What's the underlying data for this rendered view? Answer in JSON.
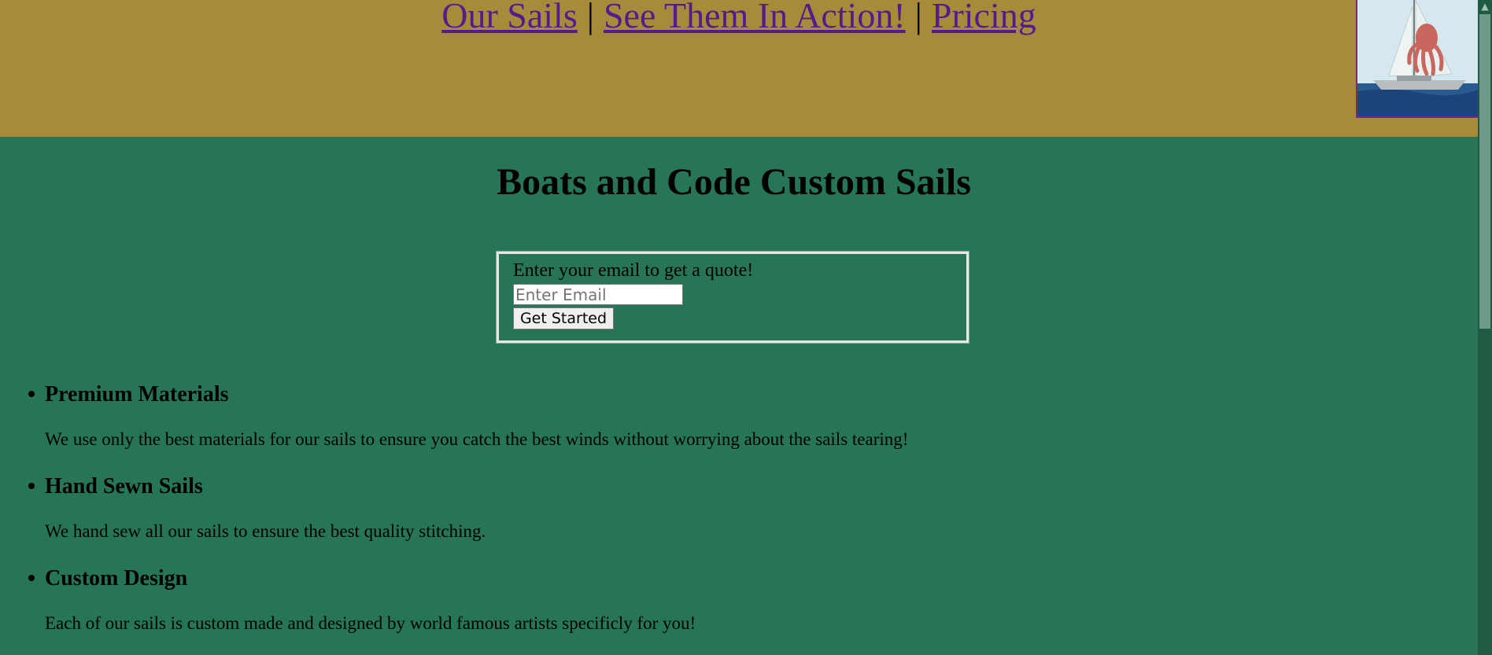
{
  "nav": {
    "links": [
      "Our Sails",
      "See Them In Action!",
      "Pricing"
    ],
    "separator": "|"
  },
  "logo": {
    "icon": "sailboat-octopus-sail-image"
  },
  "main": {
    "title": "Boats and Code Custom Sails",
    "quote_form": {
      "label": "Enter your email to get a quote!",
      "email_placeholder": "Enter Email",
      "submit_label": "Get Started"
    },
    "features": [
      {
        "title": "Premium Materials",
        "description": "We use only the best materials for our sails to ensure you catch the best winds without worrying about the sails tearing!"
      },
      {
        "title": "Hand Sewn Sails",
        "description": "We hand sew all our sails to ensure the best quality stitching."
      },
      {
        "title": "Custom Design",
        "description": "Each of our sails is custom made and designed by world famous artists specificly for you!"
      }
    ]
  },
  "colors": {
    "header_bg": "#a68c3a",
    "page_bg": "#267556",
    "link": "#551a8b"
  },
  "scrollbar": {
    "up_icon": "scroll-up-arrow-icon"
  }
}
